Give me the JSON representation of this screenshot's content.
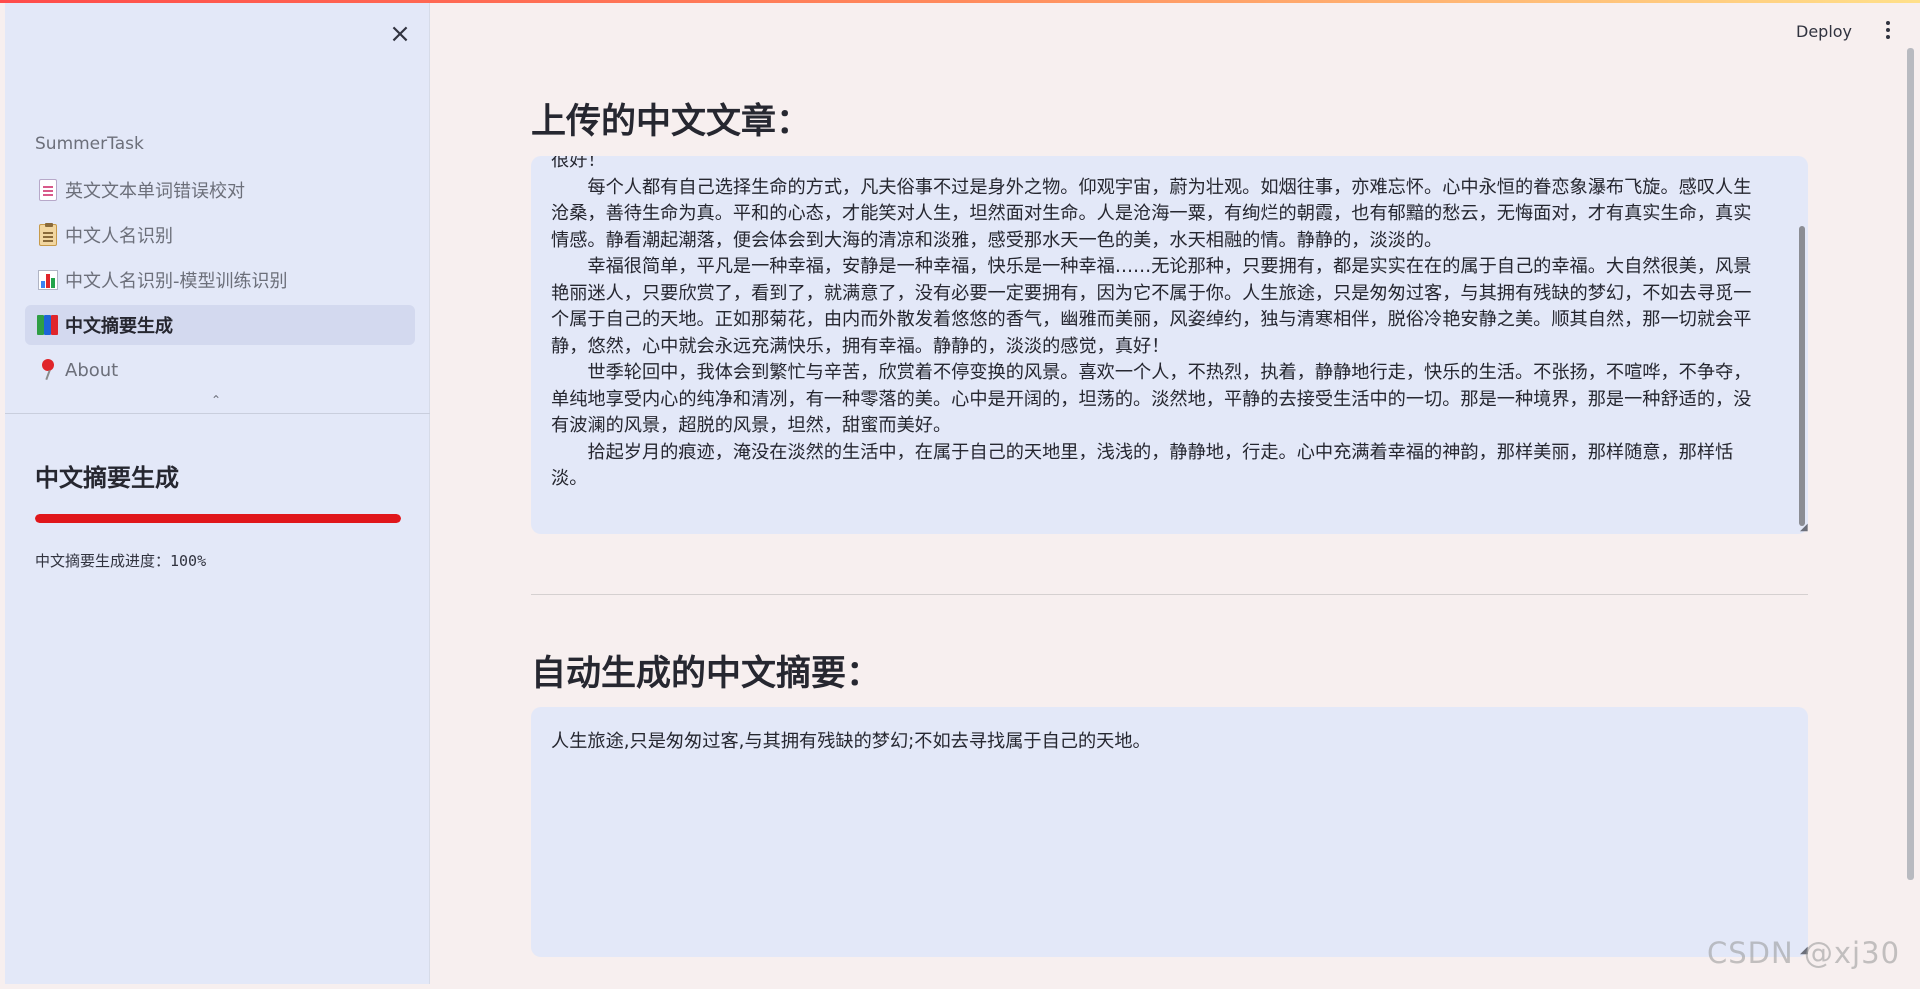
{
  "sidebar": {
    "close_label": "×",
    "section_label": "SummerTask",
    "items": [
      {
        "label": "英文文本单词错误校对",
        "icon": "document-icon",
        "active": false
      },
      {
        "label": "中文人名识别",
        "icon": "clipboard-icon",
        "active": false
      },
      {
        "label": "中文人名识别-模型训练识别",
        "icon": "bar-chart-icon",
        "active": false
      },
      {
        "label": "中文摘要生成",
        "icon": "books-icon",
        "active": true
      },
      {
        "label": "About",
        "icon": "pushpin-icon",
        "active": false
      }
    ],
    "collapse_glyph": "⌃",
    "heading": "中文摘要生成",
    "progress": {
      "value": 1.0,
      "color": "#e0161b",
      "text": "中文摘要生成进度：100%"
    }
  },
  "header": {
    "deploy_label": "Deploy"
  },
  "main": {
    "source_title": "上传的中文文章：",
    "source_paragraphs": [
      "很好！",
      "每个人都有自己选择生命的方式，凡夫俗事不过是身外之物。仰观宇宙，蔚为壮观。如烟往事，亦难忘怀。心中永恒的眷恋象瀑布飞旋。感叹人生沧桑，善待生命为真。平和的心态，才能笑对人生，坦然面对生命。人是沧海一粟，有绚烂的朝霞，也有郁黯的愁云，无悔面对，才有真实生命，真实情感。静看潮起潮落，便会体会到大海的清凉和淡雅，感受那水天一色的美，水天相融的情。静静的，淡淡的。",
      "幸福很简单，平凡是一种幸福，安静是一种幸福，快乐是一种幸福……无论那种，只要拥有，都是实实在在的属于自己的幸福。大自然很美，风景艳丽迷人，只要欣赏了，看到了，就满意了，没有必要一定要拥有，因为它不属于你。人生旅途，只是匆匆过客，与其拥有残缺的梦幻，不如去寻觅一个属于自己的天地。正如那菊花，由内而外散发着悠悠的香气，幽雅而美丽，风姿绰约，独与清寒相伴，脱俗冷艳安静之美。顺其自然，那一切就会平静，悠然，心中就会永远充满快乐，拥有幸福。静静的，淡淡的感觉，真好！",
      "世季轮回中，我体会到繁忙与辛苦，欣赏着不停变换的风景。喜欢一个人，不热烈，执着，静静地行走，快乐的生活。不张扬，不喧哗，不争夺，单纯地享受内心的纯净和清冽，有一种零落的美。心中是开阔的，坦荡的。淡然地，平静的去接受生活中的一切。那是一种境界，那是一种舒适的，没有波澜的风景，超脱的风景，坦然，甜蜜而美好。",
      "拾起岁月的痕迹，淹没在淡然的生活中，在属于自己的天地里，浅浅的，静静地，行走。心中充满着幸福的神韵，那样美丽，那样随意，那样恬淡。"
    ],
    "summary_title": "自动生成的中文摘要：",
    "summary_text": "人生旅途,只是匆匆过客,与其拥有残缺的梦幻;不如去寻找属于自己的天地。"
  },
  "watermark": "CSDN @xj30"
}
